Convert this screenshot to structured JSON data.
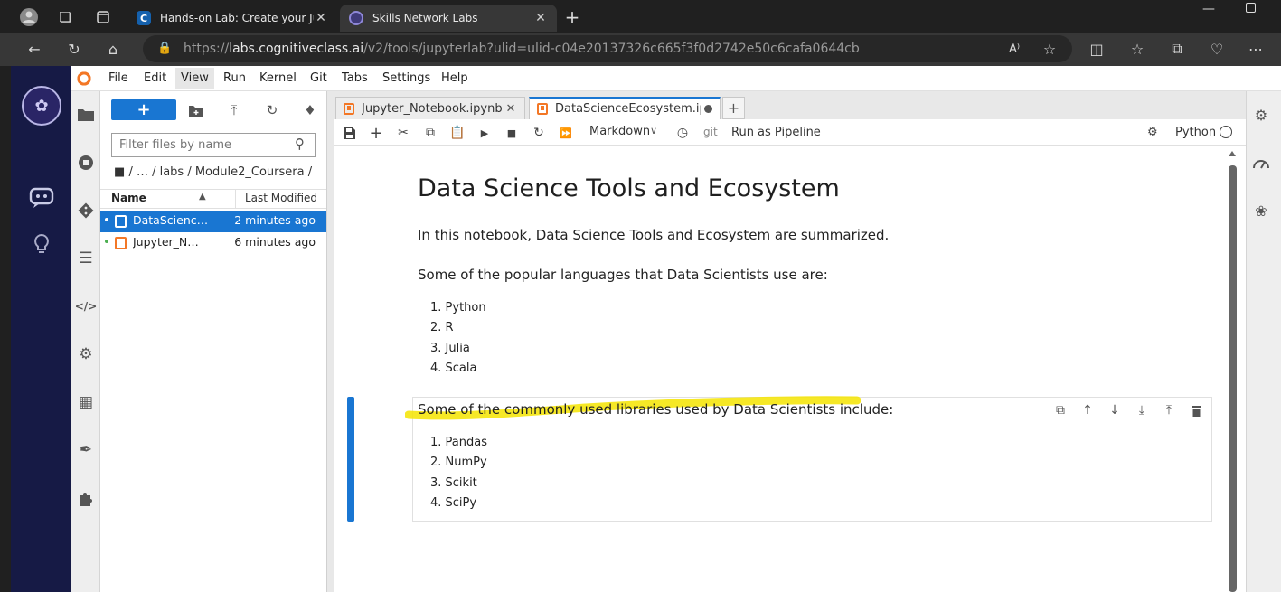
{
  "browser": {
    "tabs": [
      {
        "title": "Hands-on Lab: Create your Jupyt",
        "favicon": "cognitiveclass-c-icon"
      },
      {
        "title": "Skills Network Labs",
        "favicon": "skills-network-icon"
      }
    ],
    "address": {
      "scheme": "https://",
      "host": "labs.cognitiveclass.ai",
      "path": "/v2/tools/jupyterlab?ulid=ulid-c04e20137326c665f3f0d2742e50c6cafa0644cb"
    },
    "read_aloud": "A⁾"
  },
  "jupyter": {
    "menu": [
      "File",
      "Edit",
      "View",
      "Run",
      "Kernel",
      "Git",
      "Tabs",
      "Settings",
      "Help"
    ],
    "active_menu": "View",
    "filebrowser": {
      "new_label": "+",
      "filter_placeholder": "Filter files by name",
      "breadcrumb": "/  …  / labs / Module2_Coursera /",
      "col_name": "Name",
      "col_modified": "Last Modified",
      "files": [
        {
          "name": "DataScienceEcosystem.ipynb",
          "display": "DataScienc…",
          "modified": "2 minutes ago",
          "selected": true
        },
        {
          "name": "Jupyter_Notebook.ipynb",
          "display": "Jupyter_N…",
          "modified": "6 minutes ago",
          "selected": false
        }
      ]
    },
    "tabs": [
      {
        "title": "Jupyter_Notebook.ipynb",
        "close": "✕"
      },
      {
        "title": "DataScienceEcosystem.ipyn",
        "unsaved": true
      }
    ],
    "toolbar": {
      "cell_type": "Markdown",
      "git": "git",
      "pipeline": "Run as Pipeline",
      "kernel": "Python"
    },
    "notebook": {
      "title": "Data Science Tools and Ecosystem",
      "intro": "In this notebook, Data Science Tools and Ecosystem are summarized.",
      "languages_intro": "Some of the popular languages that Data Scientists use are:",
      "languages": [
        "1. Python",
        "2. R",
        "3. Julia",
        "4. Scala"
      ],
      "libraries_intro": "Some of the commonly used libraries used by Data Scientists include:",
      "libraries": [
        "1. Pandas",
        "2. NumPy",
        "3. Scikit",
        "4. SciPy"
      ]
    },
    "colors": {
      "accent": "#1976d2",
      "highlight": "#f5e400",
      "notebook_icon": "#f37726",
      "sidebar": "#161a45"
    }
  }
}
